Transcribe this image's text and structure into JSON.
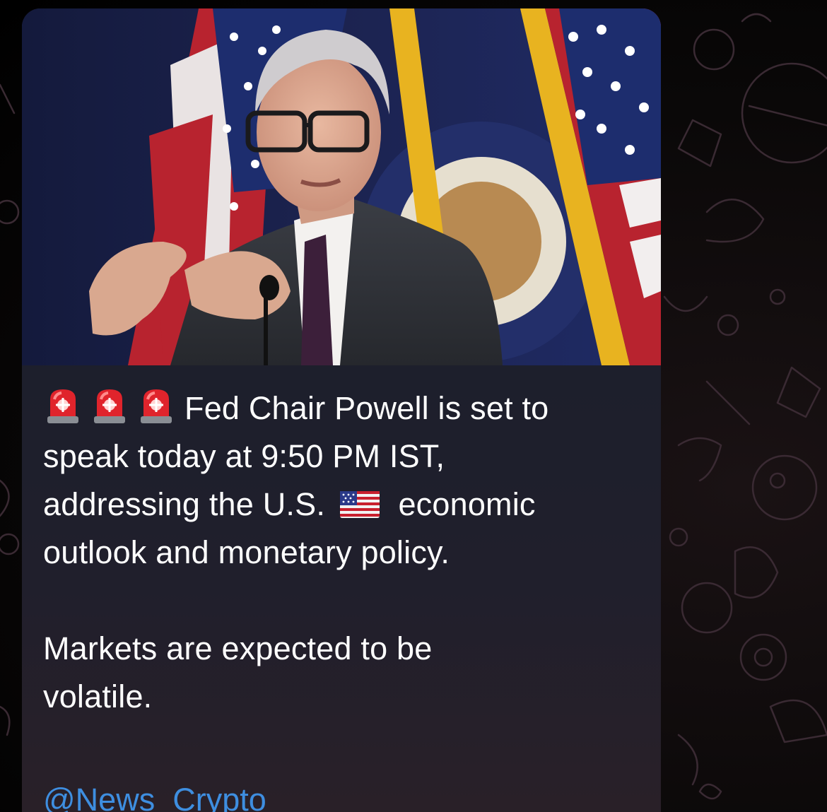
{
  "message": {
    "photo": {
      "alt_icon": "press-conference-photo"
    },
    "caption": {
      "line_1": "Fed Chair Powell is set to",
      "line_2": "speak today at 9:50 PM IST,",
      "line_3_prefix": "addressing the U.S.",
      "line_3_suffix": "economic",
      "line_4": "outlook and monetary policy.",
      "line_5": "Markets are expected to be",
      "line_6": "volatile."
    },
    "emojis": [
      "rotating-light-icon",
      "rotating-light-icon",
      "rotating-light-icon",
      "us-flag-icon"
    ],
    "channel_link": "@News_Crypto"
  },
  "colors": {
    "bubble": "#201f2c",
    "link": "#3e8ee0",
    "text": "#ffffff",
    "siren_red": "#e0242c"
  }
}
